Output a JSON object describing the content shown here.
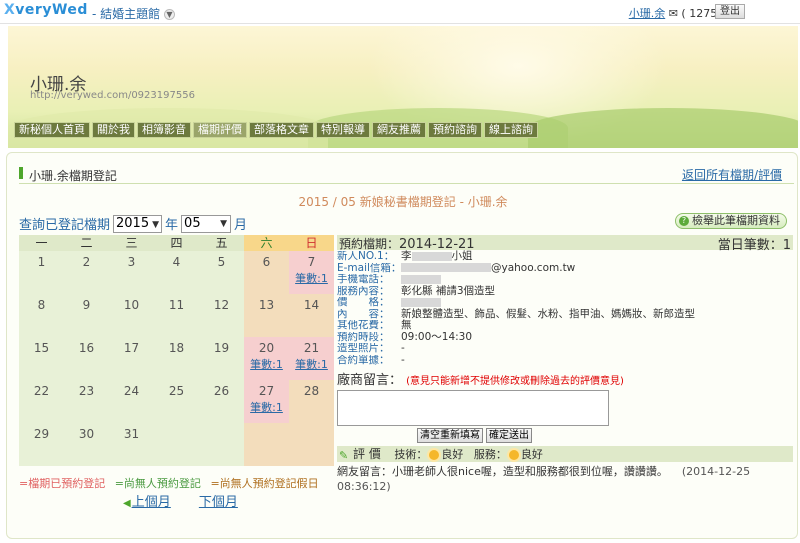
{
  "topbar": {
    "logo_prefix": "X",
    "logo_text": "veryWed",
    "theme_link": "- 結婚主題館",
    "user_name": "小珊.余",
    "user_count": "( 1275 )",
    "logout_label": "登出"
  },
  "banner": {
    "title": "小珊.余",
    "url": "http://verywed.com/0923197556"
  },
  "nav": {
    "items": [
      "新秘個人首頁",
      "關於我",
      "相簿影音",
      "檔期評價",
      "部落格文章",
      "特別報導",
      "網友推薦",
      "預約諮詢",
      "線上諮詢"
    ],
    "active_index": 3
  },
  "section": {
    "title": "小珊.余檔期登記",
    "back_link": "返回所有檔期/評價"
  },
  "subtitle": "2015 / 05 新娘秘書檔期登記 - 小珊.余",
  "query": {
    "label": "查詢已登記檔期",
    "year": "2015",
    "year_unit": "年",
    "month": "05",
    "month_unit": "月"
  },
  "report_button": "檢舉此筆檔期資料",
  "calendar": {
    "weekdays": [
      "一",
      "二",
      "三",
      "四",
      "五",
      "六",
      "日"
    ],
    "weeks": [
      [
        {
          "d": "1"
        },
        {
          "d": "2"
        },
        {
          "d": "3"
        },
        {
          "d": "4"
        },
        {
          "d": "5"
        },
        {
          "d": "6"
        },
        {
          "d": "7",
          "c": "筆數:1"
        }
      ],
      [
        {
          "d": "8"
        },
        {
          "d": "9"
        },
        {
          "d": "10"
        },
        {
          "d": "11"
        },
        {
          "d": "12"
        },
        {
          "d": "13"
        },
        {
          "d": "14"
        }
      ],
      [
        {
          "d": "15"
        },
        {
          "d": "16"
        },
        {
          "d": "17"
        },
        {
          "d": "18"
        },
        {
          "d": "19"
        },
        {
          "d": "20",
          "c": "筆數:1"
        },
        {
          "d": "21",
          "c": "筆數:1"
        }
      ],
      [
        {
          "d": "22"
        },
        {
          "d": "23"
        },
        {
          "d": "24"
        },
        {
          "d": "25"
        },
        {
          "d": "26"
        },
        {
          "d": "27",
          "c": "筆數:1"
        },
        {
          "d": "28"
        }
      ],
      [
        {
          "d": "29"
        },
        {
          "d": "30"
        },
        {
          "d": "31"
        },
        {
          "d": ""
        },
        {
          "d": ""
        },
        {
          "d": ""
        },
        {
          "d": ""
        }
      ]
    ]
  },
  "legend": {
    "booked": "=檔期已預約登記",
    "free": "=尚無人預約登記",
    "free_holiday": "=尚無人預約登記假日"
  },
  "pager": {
    "prev": "上個月",
    "next": "下個月"
  },
  "detail": {
    "date_label": "預約檔期：",
    "date_value": "2014-12-21",
    "count_label": "當日筆數：",
    "count_value": "1",
    "rows": [
      {
        "k": "新人NO.1：",
        "v": "李",
        "tail": "小姐"
      },
      {
        "k": "E-mail信箱：",
        "v": "",
        "tail": "@yahoo.com.tw"
      },
      {
        "k": "手機電話：",
        "v": ""
      },
      {
        "k": "服務內容：",
        "v": "彰化縣 補請3個造型"
      },
      {
        "k": "價　　格：",
        "v": ""
      },
      {
        "k": "內　　容：",
        "v": "新娘整體造型、飾品、假髮、水粉、指甲油、媽媽妝、新郎造型"
      },
      {
        "k": "其他花費：",
        "v": "無"
      },
      {
        "k": "預約時段：",
        "v": "09:00～14:30"
      },
      {
        "k": "造型照片：",
        "v": "-"
      },
      {
        "k": "合約單據：",
        "v": "-"
      }
    ],
    "message_label": "廠商留言：",
    "message_warn": "(意見只能新增不提供修改或刪除過去的評價意見)",
    "clear_button": "清空重新填寫",
    "submit_button": "確定送出",
    "review_title": "評 價",
    "tech_label": "技術：",
    "tech_value": "良好",
    "service_label": "服務：",
    "service_value": "良好",
    "review_text": "網友留言：小珊老師人很nice喔，造型和服務都很到位喔，讚讚讚。",
    "review_time": "(2014-12-25 08:36:12)"
  },
  "colors": {
    "accent": "#2a6aa6",
    "booked": "#f6cfcf",
    "weekday_cell": "#e8f1d7",
    "weekend_cell": "#f3ddbc"
  }
}
